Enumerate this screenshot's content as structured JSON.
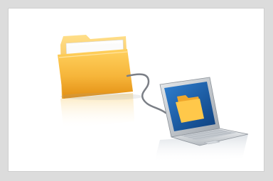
{
  "image": {
    "subject": "folder-connected-to-laptop",
    "icons": [
      "folder-icon",
      "cable-icon",
      "laptop-icon"
    ],
    "colors": {
      "frame": "#dcdcdc",
      "card": "#ffffff",
      "folder_light": "#ffd46a",
      "folder_mid": "#f6b53a",
      "folder_dark": "#e08e10",
      "laptop_body": "#cfd3d8",
      "laptop_screen": "#1a5fae",
      "cable": "#7b7f86"
    }
  }
}
